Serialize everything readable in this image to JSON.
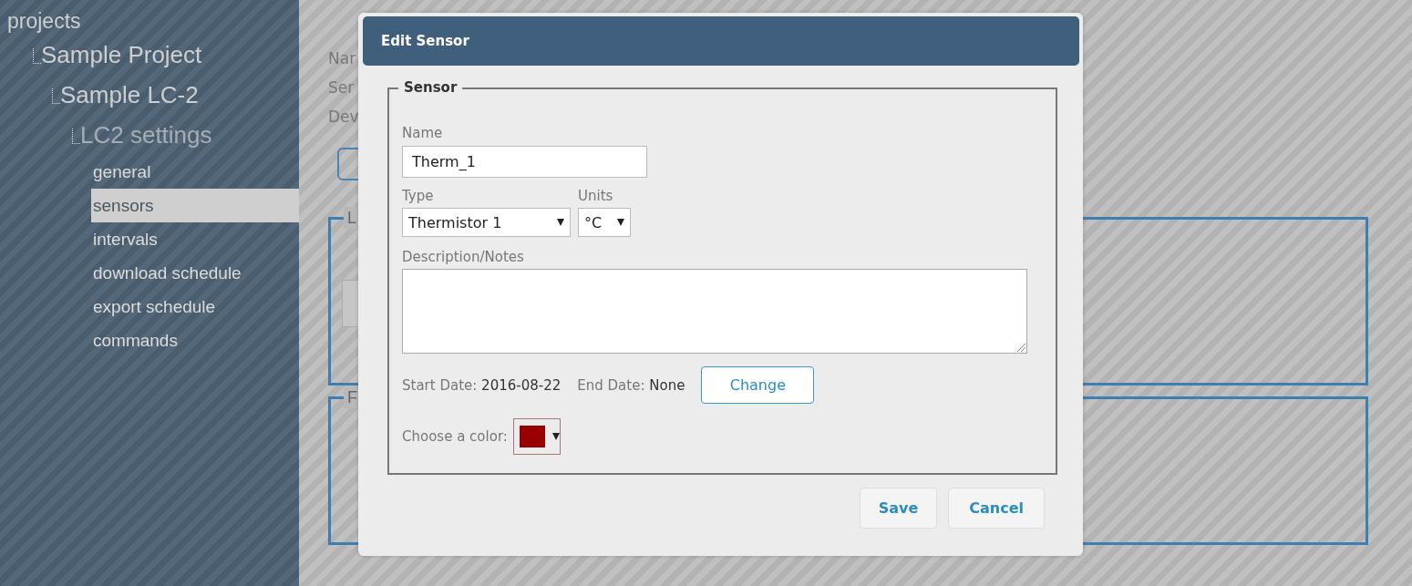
{
  "sidebar": {
    "tree": {
      "label": "projects",
      "children": [
        {
          "label": "Sample Project",
          "children": [
            {
              "label": "Sample LC-2",
              "children": [
                {
                  "label": "LC2 settings"
                }
              ]
            }
          ]
        }
      ]
    },
    "menu": [
      {
        "label": "general",
        "selected": false
      },
      {
        "label": "sensors",
        "selected": true
      },
      {
        "label": "intervals",
        "selected": false
      },
      {
        "label": "download schedule",
        "selected": false
      },
      {
        "label": "export schedule",
        "selected": false
      },
      {
        "label": "commands",
        "selected": false
      }
    ]
  },
  "page": {
    "field_labels": [
      "Nar",
      "Ser",
      "Dev"
    ],
    "sections": [
      {
        "legend": "L"
      },
      {
        "legend": "F"
      }
    ]
  },
  "dialog": {
    "title": "Edit Sensor",
    "legend": "Sensor",
    "name": {
      "label": "Name",
      "value": "Therm_1"
    },
    "type": {
      "label": "Type",
      "value": "Thermistor 1"
    },
    "units": {
      "label": "Units",
      "value": "°C"
    },
    "description": {
      "label": "Description/Notes"
    },
    "start_date": {
      "label": "Start Date:",
      "value": "2016-08-22"
    },
    "end_date": {
      "label": "End Date:",
      "value": "None"
    },
    "change_button": "Change",
    "color_picker": {
      "label": "Choose a color:",
      "color": "#990000"
    },
    "buttons": [
      "Save",
      "Cancel"
    ]
  }
}
